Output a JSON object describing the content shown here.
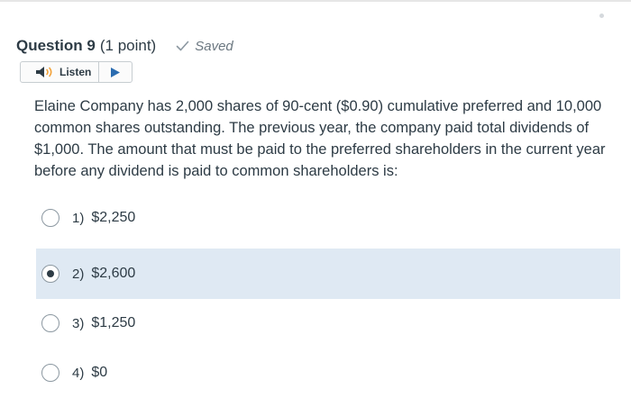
{
  "question": {
    "title": "Question 9",
    "points": "(1 point)",
    "status": "Saved",
    "text": "Elaine Company has 2,000 shares of 90-cent ($0.90) cumulative preferred and 10,000 common shares outstanding. The previous year, the company paid total dividends of $1,000. The amount that must be paid to the preferred shareholders in the current year before any dividend is paid to common shareholders is:"
  },
  "listen": {
    "label": "Listen",
    "speaker_icon": "speaker-icon",
    "play_icon": "play-icon"
  },
  "options": [
    {
      "number": "1)",
      "value": "$2,250",
      "selected": false
    },
    {
      "number": "2)",
      "value": "$2,600",
      "selected": true
    },
    {
      "number": "3)",
      "value": "$1,250",
      "selected": false
    },
    {
      "number": "4)",
      "value": "$0",
      "selected": false
    }
  ],
  "colors": {
    "text": "#2d3b45",
    "selected_background": "#dfe9f3",
    "saved_text": "#6b7780"
  }
}
